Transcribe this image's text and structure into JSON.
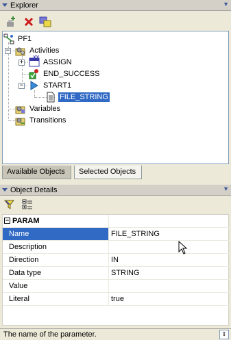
{
  "explorer": {
    "title": "Explorer",
    "toolbar": {
      "add": "add-icon",
      "delete": "delete-icon",
      "properties": "properties-icon"
    },
    "tree": {
      "root": "PF1",
      "activities": "Activities",
      "assign": "ASSIGN",
      "assign_badge": "XY",
      "end_success": "END_SUCCESS",
      "start1": "START1",
      "file_string": "FILE_STRING",
      "variables": "Variables",
      "transitions": "Transitions"
    },
    "tabs": {
      "available": "Available Objects",
      "selected": "Selected Objects"
    }
  },
  "object_details": {
    "title": "Object Details",
    "section": "PARAM",
    "rows": [
      {
        "name": "Name",
        "value": "FILE_STRING"
      },
      {
        "name": "Description",
        "value": ""
      },
      {
        "name": "Direction",
        "value": "IN"
      },
      {
        "name": "Data type",
        "value": "STRING"
      },
      {
        "name": "Value",
        "value": ""
      },
      {
        "name": "Literal",
        "value": "true"
      }
    ]
  },
  "status": {
    "text": "The name of the parameter."
  },
  "colors": {
    "selection": "#316ac5",
    "panel_header": "#d4d0c8",
    "accent": "#3a5a9a"
  }
}
